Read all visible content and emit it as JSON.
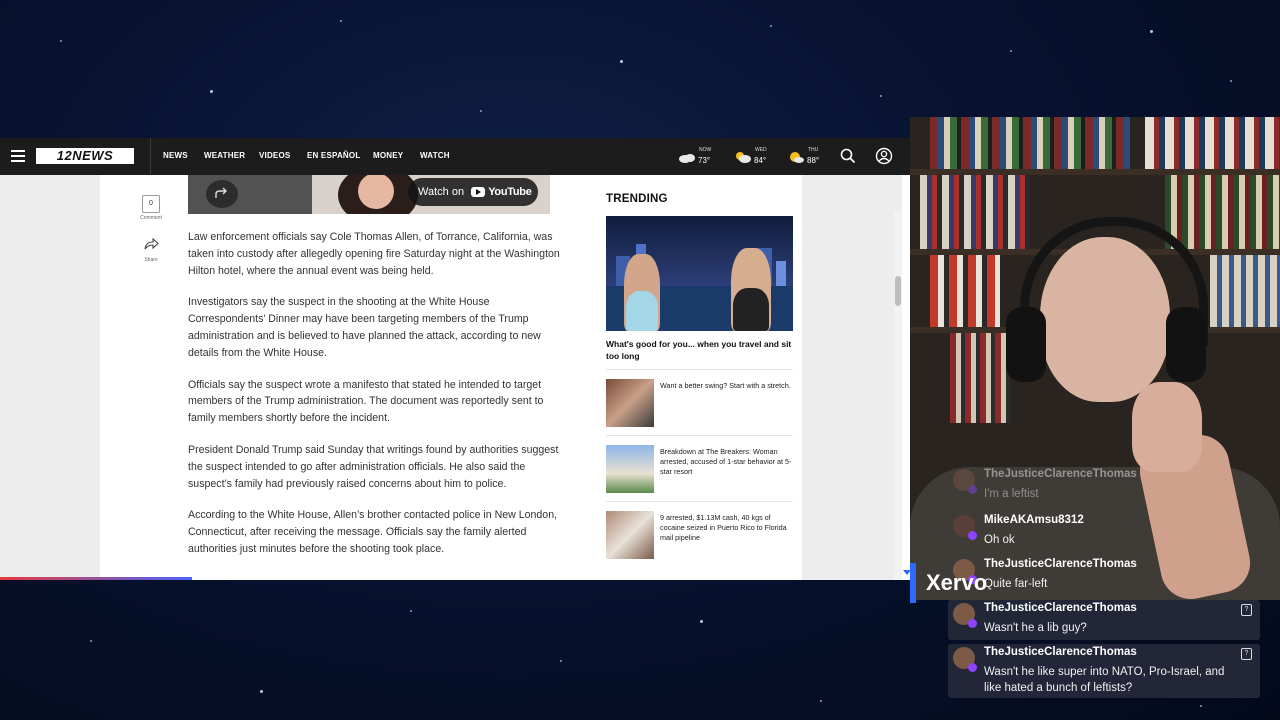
{
  "nav": {
    "logo": "12NEWS",
    "links": [
      "NEWS",
      "WEATHER",
      "VIDEOS",
      "EN ESPAÑOL",
      "MONEY",
      "WATCH"
    ],
    "weather": [
      {
        "label": "NOW",
        "temp": "73°",
        "icon": "partly-cloudy-icon"
      },
      {
        "label": "WED",
        "temp": "84°",
        "icon": "partly-sunny-icon"
      },
      {
        "label": "THU",
        "temp": "88°",
        "icon": "sunny-icon"
      }
    ]
  },
  "video": {
    "watch_label": "Watch on",
    "youtube_label": "YouTube"
  },
  "tools": {
    "comment_count": "0",
    "comment_label": "Comment",
    "share_label": "Share"
  },
  "article": {
    "paragraphs": [
      "Law enforcement officials say Cole Thomas Allen, of Torrance, California, was taken into custody after allegedly opening fire Saturday night at the Washington Hilton hotel, where the annual event was being held.",
      "Investigators say the suspect in the shooting at the White House Correspondents’ Dinner may have been targeting members of the Trump administration and is believed to have planned the attack, according to new details from the White House.",
      "Officials say the suspect wrote a manifesto that stated he intended to target members of the Trump administration. The document was reportedly sent to family members shortly before the incident.",
      "President Donald Trump said Sunday that writings found by authorities suggest the suspect intended to go after administration officials. He also said the suspect’s family had previously raised concerns about him to police.",
      "According to the White House, Allen’s brother contacted police in New London, Connecticut, after receiving the message. Officials say the family alerted authorities just minutes before the shooting took place."
    ]
  },
  "trending": {
    "title": "TRENDING",
    "hero_caption": "What's good for you... when you travel and sit too long",
    "items": [
      "Want a better swing? Start with a stretch.",
      "Breakdown at The Breakers: Woman arrested, accused of 1-star behavior at 5-star resort",
      "9 arrested, $1.13M cash, 40 kgs of cocaine seized in Puerto Rico to Florida mail pipeline"
    ]
  },
  "overlay": {
    "name_tag": "Xervo"
  },
  "chat": [
    {
      "user": "TheJusticeClarenceThomas",
      "text": "I'm a leftist",
      "faded": true
    },
    {
      "user": "MikeAKAmsu8312",
      "text": "Oh ok"
    },
    {
      "user": "TheJusticeClarenceThomas",
      "text": "Quite far-left"
    },
    {
      "user": "TheJusticeClarenceThomas",
      "text": "Wasn't he a lib guy?"
    },
    {
      "user": "TheJusticeClarenceThomas",
      "text": "Wasn't he like super into NATO, Pro-Israel, and like hated a bunch of leftists?"
    }
  ]
}
